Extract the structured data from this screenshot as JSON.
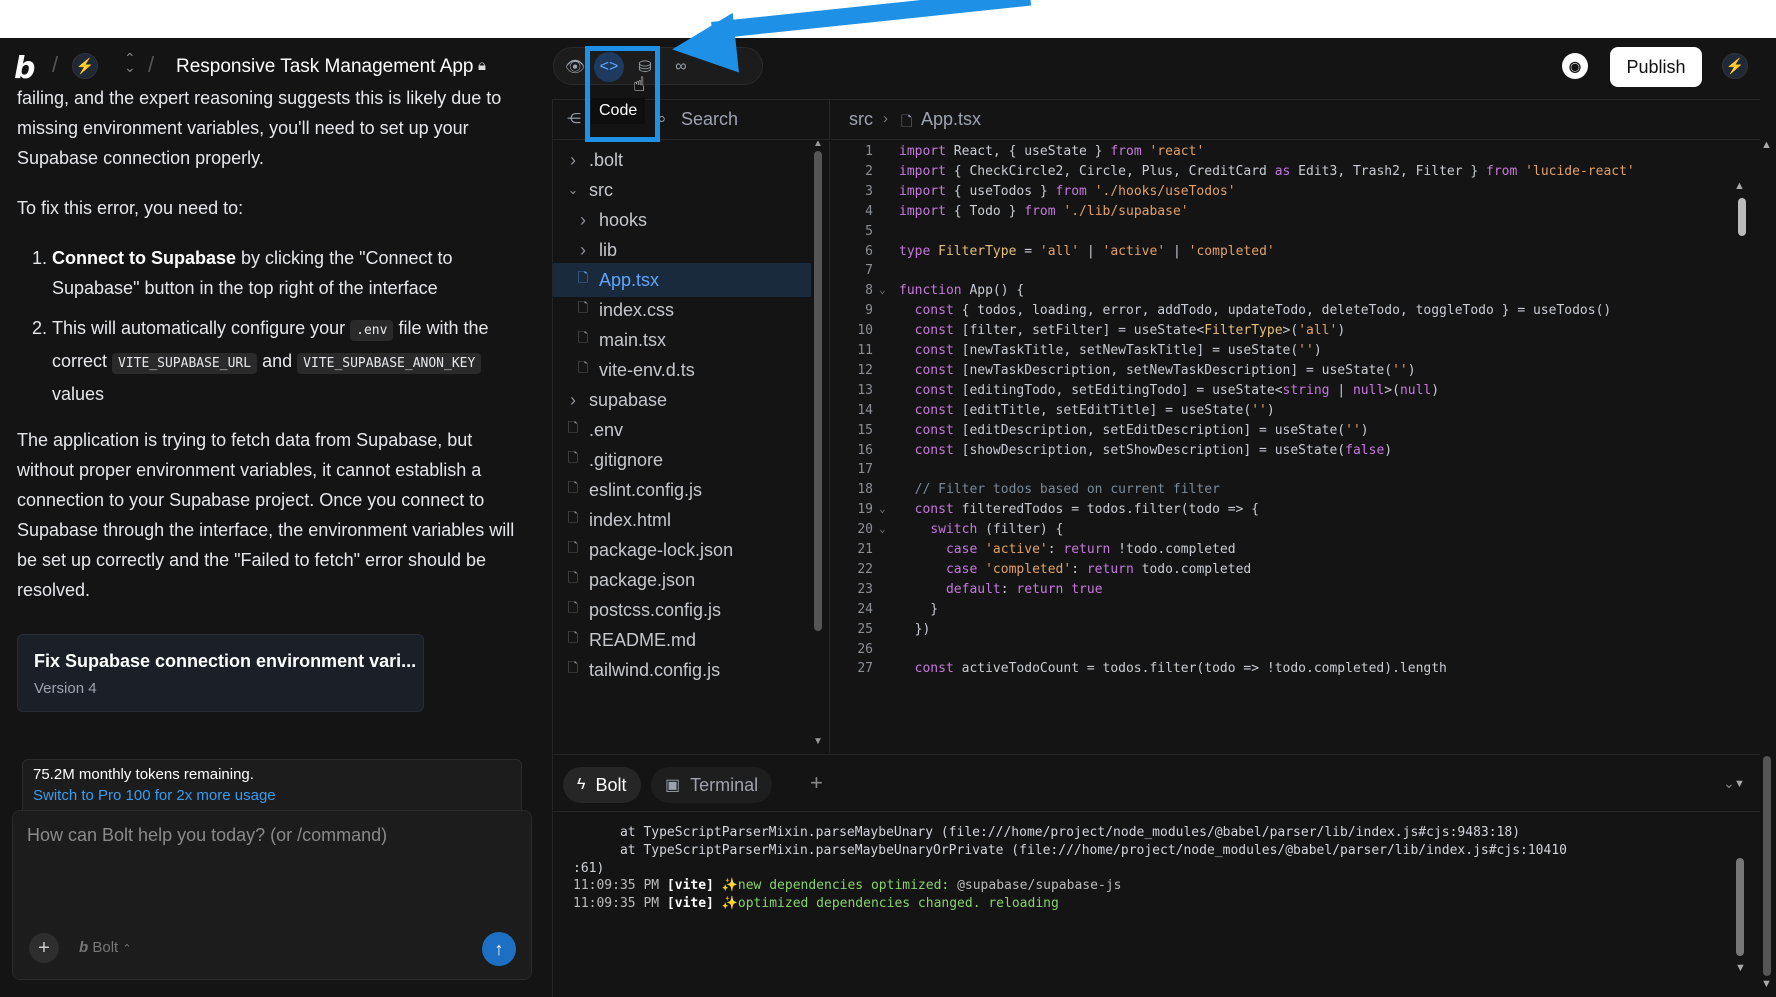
{
  "header": {
    "project_title": "Responsive Task Management App",
    "publish_label": "Publish",
    "tooltip": "Code"
  },
  "chat": {
    "paragraph1": "failing, and the expert reasoning suggests this is likely due to missing environment variables, you'll need to set up your Supabase connection properly.",
    "paragraph2": "To fix this error, you need to:",
    "step1_bold": "Connect to Supabase",
    "step1_rest": " by clicking the \"Connect to Supabase\" button in the top right of the interface",
    "step2_pre": "This will automatically configure your ",
    "step2_code1": ".env",
    "step2_mid": " file with the correct ",
    "step2_code2": "VITE_SUPABASE_URL",
    "step2_and": " and ",
    "step2_code3": "VITE_SUPABASE_ANON_KEY",
    "step2_post": " values",
    "paragraph3": "The application is trying to fetch data from Supabase, but without proper environment variables, it cannot establish a connection to your Supabase project. Once you connect to Supabase through the interface, the environment variables will be set up correctly and the \"Failed to fetch\" error should be resolved.",
    "version_card": {
      "title": "Fix Supabase connection environment vari...",
      "subtitle": "Version 4"
    },
    "tokens": {
      "remaining": "75.2M monthly tokens remaining.",
      "upgrade_link": "Switch to Pro 100 for 2x more usage"
    },
    "input": {
      "placeholder": "How can Bolt help you today? (or /command)",
      "model": "Bolt"
    }
  },
  "file_tree": {
    "search_label": "Search",
    "items": [
      {
        "name": ".bolt",
        "type": "folder-closed",
        "depth": 0
      },
      {
        "name": "src",
        "type": "folder-open",
        "depth": 0
      },
      {
        "name": "hooks",
        "type": "folder-closed",
        "depth": 1
      },
      {
        "name": "lib",
        "type": "folder-closed",
        "depth": 1
      },
      {
        "name": "App.tsx",
        "type": "file",
        "depth": 1,
        "active": true
      },
      {
        "name": "index.css",
        "type": "file",
        "depth": 1
      },
      {
        "name": "main.tsx",
        "type": "file",
        "depth": 1
      },
      {
        "name": "vite-env.d.ts",
        "type": "file",
        "depth": 1
      },
      {
        "name": "supabase",
        "type": "folder-closed",
        "depth": 0
      },
      {
        "name": ".env",
        "type": "file",
        "depth": 0
      },
      {
        "name": ".gitignore",
        "type": "file",
        "depth": 0
      },
      {
        "name": "eslint.config.js",
        "type": "file",
        "depth": 0
      },
      {
        "name": "index.html",
        "type": "file",
        "depth": 0
      },
      {
        "name": "package-lock.json",
        "type": "file",
        "depth": 0
      },
      {
        "name": "package.json",
        "type": "file",
        "depth": 0
      },
      {
        "name": "postcss.config.js",
        "type": "file",
        "depth": 0
      },
      {
        "name": "README.md",
        "type": "file",
        "depth": 0
      },
      {
        "name": "tailwind.config.js",
        "type": "file",
        "depth": 0
      }
    ]
  },
  "editor": {
    "breadcrumb": [
      "src",
      "App.tsx"
    ],
    "lines": [
      {
        "n": "1",
        "fold": "",
        "html": "<span class=\"kw\">import</span> React, { useState } <span class=\"kw\">from</span> <span class=\"str\">'react'</span>"
      },
      {
        "n": "2",
        "fold": "",
        "html": "<span class=\"kw\">import</span> { CheckCircle2, Circle, Plus, CreditCard <span class=\"kw\">as</span> Edit3, Trash2, Filter } <span class=\"kw\">from</span> <span class=\"str\">'lucide-react'</span>"
      },
      {
        "n": "3",
        "fold": "",
        "html": "<span class=\"kw\">import</span> { useTodos } <span class=\"kw\">from</span> <span class=\"str\">'./hooks/useTodos'</span>"
      },
      {
        "n": "4",
        "fold": "",
        "html": "<span class=\"kw\">import</span> { Todo } <span class=\"kw\">from</span> <span class=\"str\">'./lib/supabase'</span>"
      },
      {
        "n": "5",
        "fold": "",
        "html": ""
      },
      {
        "n": "6",
        "fold": "",
        "html": "<span class=\"kw\">type</span> <span class=\"ty\">FilterType</span> = <span class=\"str\">'all'</span> | <span class=\"str\">'active'</span> | <span class=\"str\">'completed'</span>"
      },
      {
        "n": "7",
        "fold": "",
        "html": ""
      },
      {
        "n": "8",
        "fold": "v",
        "html": "<span class=\"kw\">function</span> App() {"
      },
      {
        "n": "9",
        "fold": "",
        "html": "  <span class=\"kw\">const</span> { todos, loading, error, addTodo, updateTodo, deleteTodo, toggleTodo } = useTodos()"
      },
      {
        "n": "10",
        "fold": "",
        "html": "  <span class=\"kw\">const</span> [filter, setFilter] = useState&lt;<span class=\"ty\">FilterType</span>&gt;(<span class=\"str\">'all'</span>)"
      },
      {
        "n": "11",
        "fold": "",
        "html": "  <span class=\"kw\">const</span> [newTaskTitle, setNewTaskTitle] = useState(<span class=\"str\">''</span>)"
      },
      {
        "n": "12",
        "fold": "",
        "html": "  <span class=\"kw\">const</span> [newTaskDescription, setNewTaskDescription] = useState(<span class=\"str\">''</span>)"
      },
      {
        "n": "13",
        "fold": "",
        "html": "  <span class=\"kw\">const</span> [editingTodo, setEditingTodo] = useState&lt;<span class=\"kw\">string</span> | <span class=\"kw\">null</span>&gt;(<span class=\"kw\">null</span>)"
      },
      {
        "n": "14",
        "fold": "",
        "html": "  <span class=\"kw\">const</span> [editTitle, setEditTitle] = useState(<span class=\"str\">''</span>)"
      },
      {
        "n": "15",
        "fold": "",
        "html": "  <span class=\"kw\">const</span> [editDescription, setEditDescription] = useState(<span class=\"str\">''</span>)"
      },
      {
        "n": "16",
        "fold": "",
        "html": "  <span class=\"kw\">const</span> [showDescription, setShowDescription] = useState(<span class=\"kw\">false</span>)"
      },
      {
        "n": "17",
        "fold": "",
        "html": ""
      },
      {
        "n": "18",
        "fold": "",
        "html": "  <span class=\"cm\">// Filter todos based on current filter</span>"
      },
      {
        "n": "19",
        "fold": "v",
        "html": "  <span class=\"kw\">const</span> filteredTodos = todos.filter(todo =&gt; {"
      },
      {
        "n": "20",
        "fold": "v",
        "html": "    <span class=\"kw\">switch</span> (filter) {"
      },
      {
        "n": "21",
        "fold": "",
        "html": "      <span class=\"kw\">case</span> <span class=\"str\">'active'</span>: <span class=\"kw\">return</span> !todo.completed"
      },
      {
        "n": "22",
        "fold": "",
        "html": "      <span class=\"kw\">case</span> <span class=\"str\">'completed'</span>: <span class=\"kw\">return</span> todo.completed"
      },
      {
        "n": "23",
        "fold": "",
        "html": "      <span class=\"kw\">default</span>: <span class=\"kw\">return</span> <span class=\"kw\">true</span>"
      },
      {
        "n": "24",
        "fold": "",
        "html": "    }"
      },
      {
        "n": "25",
        "fold": "",
        "html": "  })"
      },
      {
        "n": "26",
        "fold": "",
        "html": ""
      },
      {
        "n": "27",
        "fold": "",
        "html": "  <span class=\"kw\">const</span> activeTodoCount = todos.filter(todo =&gt; !todo.completed).length"
      }
    ]
  },
  "bottom_tabs": {
    "bolt": "Bolt",
    "terminal": "Terminal"
  },
  "terminal": {
    "line1": "      at TypeScriptParserMixin.parseMaybeUnary (file:///home/project/node_modules/@babel/parser/lib/index.js#cjs:9483:18)",
    "line2": "      at TypeScriptParserMixin.parseMaybeUnaryOrPrivate (file:///home/project/node_modules/@babel/parser/lib/index.js#cjs:10410",
    "line3": ":61)",
    "line4_time": "11:09:35 PM",
    "line4_tag": "[vite]",
    "line4_msg": "new dependencies optimized: ",
    "line4_pkg": "@supabase/supabase-js",
    "line5_time": "11:09:35 PM",
    "line5_tag": "[vite]",
    "line5_msg": "optimized dependencies changed. reloading"
  },
  "colors": {
    "accent": "#1e90e6",
    "background": "#141414",
    "link": "#3b9cf0"
  }
}
